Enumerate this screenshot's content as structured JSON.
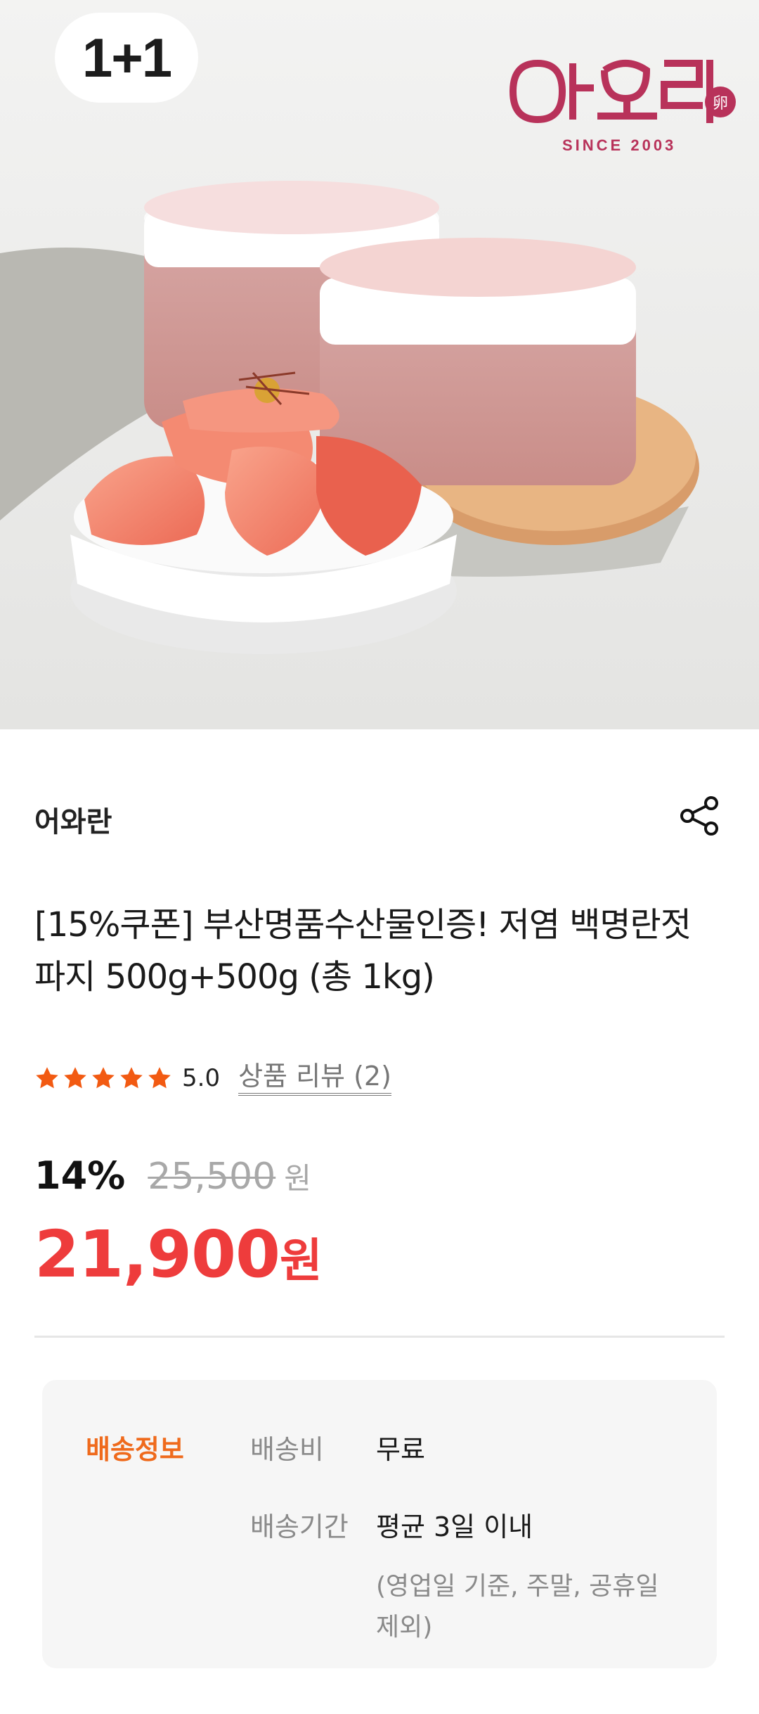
{
  "hero": {
    "badge": "1+1",
    "brand_logo_since": "SINCE 2003",
    "brand_logo_text": "어와란卵"
  },
  "product": {
    "seller": "어와란",
    "title": "[15%쿠폰] 부산명품수산물인증! 저염 백명란젓 파지 500g+500g (총 1kg)",
    "rating": {
      "stars": 5,
      "score": "5.0",
      "review_label": "상품 리뷰 (2)"
    },
    "price": {
      "discount": "14%",
      "original": "25,500",
      "original_unit": "원",
      "sale": "21,900",
      "sale_unit": "원"
    }
  },
  "shipping": {
    "title": "배송정보",
    "fee_label": "배송비",
    "fee_value": "무료",
    "period_label": "배송기간",
    "period_value": "평균 3일 이내",
    "period_note": "(영업일 기준, 주말, 공휴일 제외)"
  },
  "colors": {
    "accent_red": "#ee3c3c",
    "accent_orange": "#ef6a1c",
    "star": "#f25a12",
    "logo": "#b8325a"
  }
}
